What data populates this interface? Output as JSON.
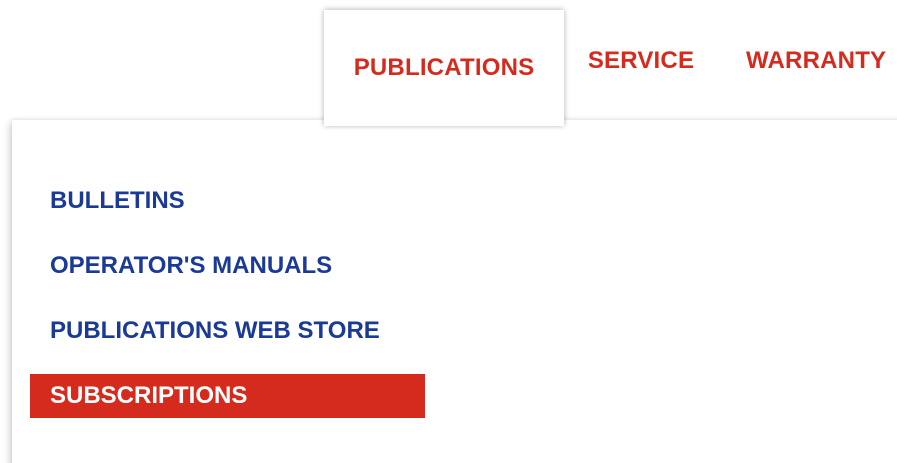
{
  "nav": {
    "tabs": [
      {
        "label": "PUBLICATIONS",
        "active": true
      },
      {
        "label": "SERVICE",
        "active": false
      },
      {
        "label": "WARRANTY",
        "active": false
      }
    ]
  },
  "dropdown": {
    "items": [
      {
        "label": "BULLETINS",
        "highlighted": false
      },
      {
        "label": "OPERATOR'S MANUALS",
        "highlighted": false
      },
      {
        "label": "PUBLICATIONS WEB STORE",
        "highlighted": false
      },
      {
        "label": "SUBSCRIPTIONS",
        "highlighted": true
      }
    ]
  },
  "colors": {
    "accent_red": "#d52b1e",
    "link_blue": "#1a3a96",
    "background": "#ffffff"
  }
}
